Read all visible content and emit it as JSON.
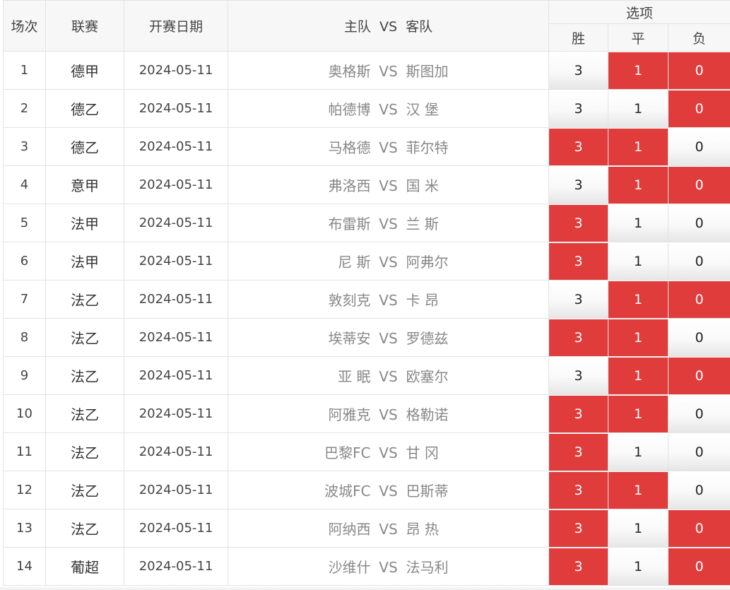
{
  "header": {
    "num": "场次",
    "league": "联赛",
    "date": "开赛日期",
    "home": "主队",
    "vs": "VS",
    "away": "客队",
    "options": "选项",
    "win": "胜",
    "draw": "平",
    "lose": "负"
  },
  "colors": {
    "selected": "#e03c3c",
    "header_bg": "#f7f7f7",
    "border": "#e3e3e3"
  },
  "rows": [
    {
      "num": "1",
      "league": "德甲",
      "date": "2024-05-11",
      "home": "奥格斯",
      "vs": "VS",
      "away": "斯图加",
      "win": "3",
      "draw": "1",
      "lose": "0",
      "win_sel": false,
      "draw_sel": true,
      "lose_sel": true
    },
    {
      "num": "2",
      "league": "德乙",
      "date": "2024-05-11",
      "home": "帕德博",
      "vs": "VS",
      "away": "汉 堡",
      "win": "3",
      "draw": "1",
      "lose": "0",
      "win_sel": false,
      "draw_sel": false,
      "lose_sel": true
    },
    {
      "num": "3",
      "league": "德乙",
      "date": "2024-05-11",
      "home": "马格德",
      "vs": "VS",
      "away": "菲尔特",
      "win": "3",
      "draw": "1",
      "lose": "0",
      "win_sel": true,
      "draw_sel": true,
      "lose_sel": false
    },
    {
      "num": "4",
      "league": "意甲",
      "date": "2024-05-11",
      "home": "弗洛西",
      "vs": "VS",
      "away": "国 米",
      "win": "3",
      "draw": "1",
      "lose": "0",
      "win_sel": false,
      "draw_sel": true,
      "lose_sel": true
    },
    {
      "num": "5",
      "league": "法甲",
      "date": "2024-05-11",
      "home": "布雷斯",
      "vs": "VS",
      "away": "兰 斯",
      "win": "3",
      "draw": "1",
      "lose": "0",
      "win_sel": true,
      "draw_sel": false,
      "lose_sel": false
    },
    {
      "num": "6",
      "league": "法甲",
      "date": "2024-05-11",
      "home": "尼 斯",
      "vs": "VS",
      "away": "阿弗尔",
      "win": "3",
      "draw": "1",
      "lose": "0",
      "win_sel": true,
      "draw_sel": false,
      "lose_sel": false
    },
    {
      "num": "7",
      "league": "法乙",
      "date": "2024-05-11",
      "home": "敦刻克",
      "vs": "VS",
      "away": "卡 昂",
      "win": "3",
      "draw": "1",
      "lose": "0",
      "win_sel": false,
      "draw_sel": true,
      "lose_sel": true
    },
    {
      "num": "8",
      "league": "法乙",
      "date": "2024-05-11",
      "home": "埃蒂安",
      "vs": "VS",
      "away": "罗德兹",
      "win": "3",
      "draw": "1",
      "lose": "0",
      "win_sel": true,
      "draw_sel": true,
      "lose_sel": false
    },
    {
      "num": "9",
      "league": "法乙",
      "date": "2024-05-11",
      "home": "亚 眠",
      "vs": "VS",
      "away": "欧塞尔",
      "win": "3",
      "draw": "1",
      "lose": "0",
      "win_sel": false,
      "draw_sel": true,
      "lose_sel": true
    },
    {
      "num": "10",
      "league": "法乙",
      "date": "2024-05-11",
      "home": "阿雅克",
      "vs": "VS",
      "away": "格勒诺",
      "win": "3",
      "draw": "1",
      "lose": "0",
      "win_sel": true,
      "draw_sel": true,
      "lose_sel": false
    },
    {
      "num": "11",
      "league": "法乙",
      "date": "2024-05-11",
      "home": "巴黎FC",
      "vs": "VS",
      "away": "甘 冈",
      "win": "3",
      "draw": "1",
      "lose": "0",
      "win_sel": true,
      "draw_sel": false,
      "lose_sel": false
    },
    {
      "num": "12",
      "league": "法乙",
      "date": "2024-05-11",
      "home": "波城FC",
      "vs": "VS",
      "away": "巴斯蒂",
      "win": "3",
      "draw": "1",
      "lose": "0",
      "win_sel": true,
      "draw_sel": true,
      "lose_sel": false
    },
    {
      "num": "13",
      "league": "法乙",
      "date": "2024-05-11",
      "home": "阿纳西",
      "vs": "VS",
      "away": "昂 热",
      "win": "3",
      "draw": "1",
      "lose": "0",
      "win_sel": true,
      "draw_sel": false,
      "lose_sel": true
    },
    {
      "num": "14",
      "league": "葡超",
      "date": "2024-05-11",
      "home": "沙维什",
      "vs": "VS",
      "away": "法马利",
      "win": "3",
      "draw": "1",
      "lose": "0",
      "win_sel": true,
      "draw_sel": false,
      "lose_sel": true
    }
  ]
}
